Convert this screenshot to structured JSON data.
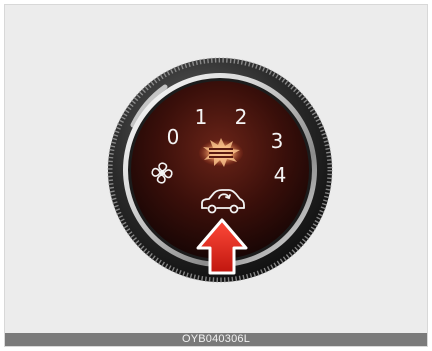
{
  "dial": {
    "numbers": [
      "0",
      "1",
      "2",
      "3",
      "4"
    ],
    "icons": [
      "fan-icon",
      "rear-defrost-icon",
      "recirculation-icon",
      "arrow-up-icon"
    ],
    "colors": {
      "face": "#3a0f0a",
      "arrow": "#e0261c",
      "heat": "#f2a36a"
    }
  },
  "caption": "OYB040306L"
}
